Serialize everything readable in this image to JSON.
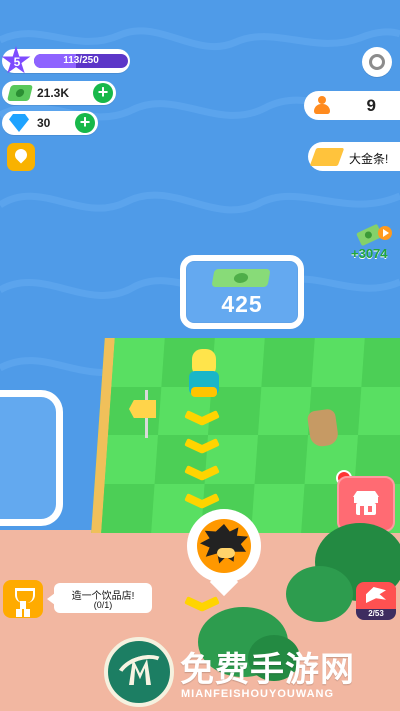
{
  "hud": {
    "level": "5",
    "xp_text": "113/250",
    "xp_progress": 0.452,
    "cash": "21.3K",
    "gems": "30",
    "people_count": "9",
    "gold_label": "大金条!",
    "reward_value": "+3074"
  },
  "world": {
    "price_value": "425"
  },
  "mission": {
    "title": "造一个饮品店!",
    "progress": "(0/1)"
  },
  "boss": {
    "count": "2/53"
  },
  "watermark": {
    "cn": "免费手游网",
    "en": "MIANFEISHOUYOUWANG"
  },
  "colors": {
    "water": "#4f9be8",
    "grass": "#52d65a",
    "xp": "#7e4bff",
    "shop": "#ff6b73",
    "accent_green": "#18b84a",
    "gold": "#ffc33c"
  },
  "icons": {
    "level": "star-icon",
    "cash": "cash-icon",
    "gems": "diamond-icon",
    "people": "person-icon",
    "settings": "gear-icon",
    "gold": "gold-bar-icon",
    "trophy": "trophy-icon",
    "boss": "dragon-icon",
    "shop": "shop-icon"
  }
}
